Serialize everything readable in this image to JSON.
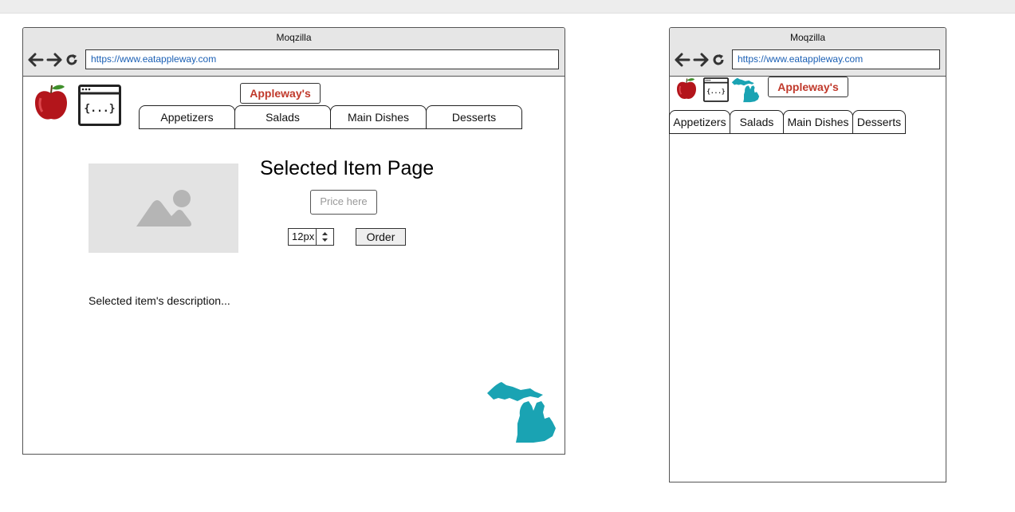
{
  "desktop": {
    "window_title": "Moqzilla",
    "url": "https://www.eatappleway.com",
    "brand": "Appleway's",
    "tabs": [
      "Appetizers",
      "Salads",
      "Main Dishes",
      "Desserts"
    ],
    "heading": "Selected Item Page",
    "price_placeholder": "Price here",
    "quantity_value": "12px",
    "order_label": "Order",
    "description": "Selected item's description..."
  },
  "mobile": {
    "window_title": "Moqzilla",
    "url": "https://www.eatappleway.com",
    "brand": "Appleway's",
    "tabs": [
      "Appetizers",
      "Salads",
      "Main Dishes",
      "Desserts"
    ]
  },
  "icons": {
    "back": "arrow-left-icon",
    "forward": "arrow-right-icon",
    "reload": "reload-icon",
    "apple": "apple-icon",
    "code_window": "code-window-icon",
    "michigan": "michigan-map-icon",
    "image_placeholder": "image-placeholder-icon"
  },
  "colors": {
    "brand_text": "#c0392b",
    "michigan": "#1aa3b3",
    "url_text": "#1a5fb4"
  }
}
